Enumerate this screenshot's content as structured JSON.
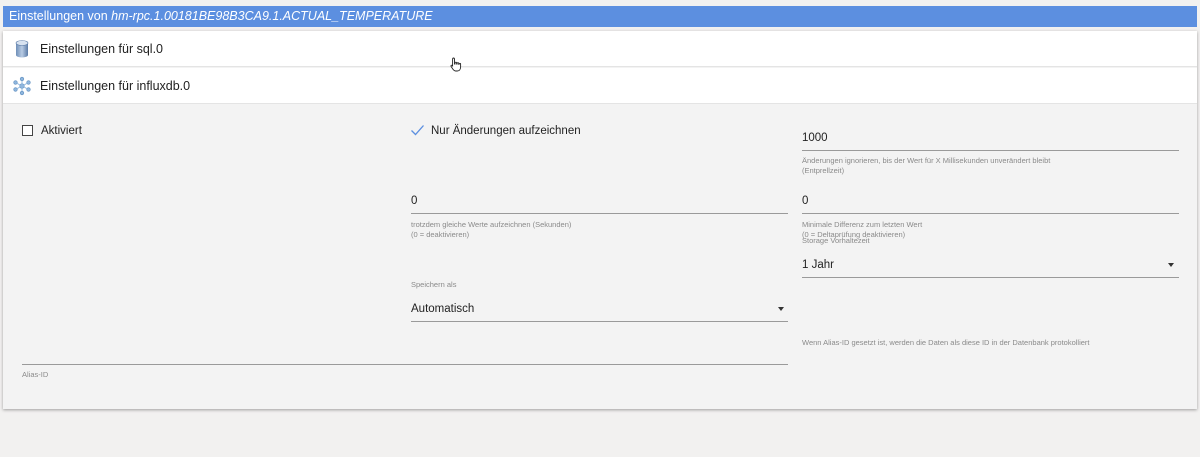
{
  "dialog": {
    "title_prefix": "Einstellungen von ",
    "title_object": "hm-rpc.1.00181BE98B3CA9.1.ACTUAL_TEMPERATURE"
  },
  "accordions": [
    {
      "label": "Einstellungen für sql.0",
      "icon": "database-icon"
    },
    {
      "label": "Einstellungen für influxdb.0",
      "icon": "influxdb-icon"
    }
  ],
  "settings": {
    "enabled": {
      "label": "Aktiviert",
      "checked": false
    },
    "changes_only": {
      "label": "Nur Änderungen aufzeichnen",
      "checked": true
    },
    "debounce": {
      "value": "1000",
      "help_line1": "Änderungen ignorieren, bis der Wert für X Millisekunden unverändert bleibt",
      "help_line2": "(Entprellzeit)"
    },
    "same_values": {
      "value": "0",
      "help_line1": "trotzdem gleiche Werte aufzeichnen (Sekunden)",
      "help_line2": "(0 = deaktivieren)"
    },
    "min_diff": {
      "value": "0",
      "help_line1": "Minimale Differenz zum letzten Wert",
      "help_line2": "(0 = Deltaprüfung deaktivieren)"
    },
    "retention": {
      "label": "Storage Vorhaltezeit",
      "value": "1 Jahr"
    },
    "store_as": {
      "label": "Speichern als",
      "value": "Automatisch"
    },
    "alias": {
      "label": "Alias-ID",
      "value": "",
      "help": "Wenn Alias-ID gesetzt ist, werden die Daten als diese ID in der Datenbank protokolliert"
    }
  },
  "colors": {
    "titlebar": "#5c8fe0",
    "check": "#5c8fe0"
  }
}
